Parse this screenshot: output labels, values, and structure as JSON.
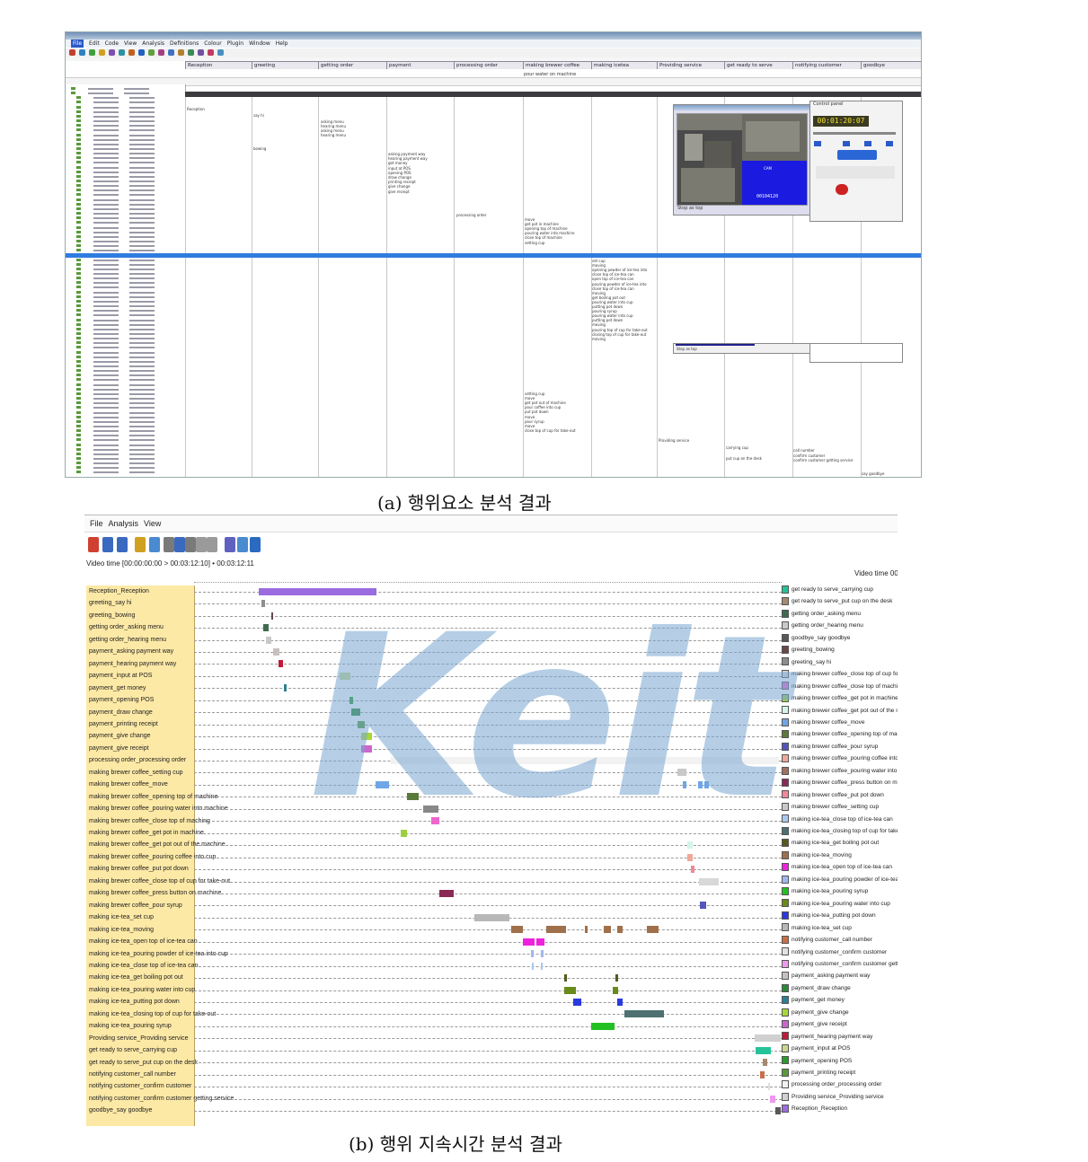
{
  "figure_a": {
    "caption": "(a) 행위요소 분석 결과",
    "menu": [
      "File",
      "Edit",
      "Code",
      "View",
      "Analysis",
      "Definitions",
      "Colour",
      "Plugin",
      "Window",
      "Help"
    ],
    "columns": [
      "Reception",
      "greeting",
      "getting order",
      "payment",
      "processing order",
      "making brewer coffee",
      "making icetea",
      "Providing service",
      "get ready to serve",
      "notifying customer",
      "goodbye"
    ],
    "top_note": "pour water on machine",
    "cells": {
      "reception": "Reception",
      "greeting": [
        "say hi",
        "bowing"
      ],
      "getting_order": [
        "asking menu",
        "hearing menu",
        "asking menu",
        "hearing menu"
      ],
      "payment": [
        "asking payment way",
        "hearing payment way",
        "get money",
        "input at POS",
        "opening POS",
        "draw change",
        "printing receipt",
        "give change",
        "give receipt"
      ],
      "processing_order": "processing order",
      "coffee_1": [
        "move",
        "get pot in machine",
        "opening top of machine",
        "pouring water into machine",
        "close top of machine",
        "setting cup"
      ],
      "icetea": [
        "set cup",
        "moving",
        "opening powder of ice-tea into",
        "close top of ice-tea can",
        "open top of ice-tea can",
        "pouring powder of ice-tea into",
        "close top of ice-tea can",
        "moving",
        "get boiling pot out",
        "pouring water into cup",
        "putting pot down",
        "pouring syrup",
        "pouring water into cup",
        "putting pot down",
        "moving",
        "pouring top of cup for take-out",
        "closing top of cup for take-out",
        "moving"
      ],
      "coffee_2": [
        "setting cup",
        "move",
        "get pot out of machine",
        "pour coffee into cup",
        "put pot down",
        "move",
        "pour syrup",
        "move",
        "close top of cup for take-out"
      ],
      "providing": "Providing service",
      "ready": [
        "carrying cup",
        "put cup on the desk"
      ],
      "notifying": [
        "call number",
        "confirm customer",
        "confirm customer getting service"
      ],
      "goodbye": "say goodbye"
    },
    "video_caption": "Stop as top",
    "video_caption_2": "Stop as top",
    "video_timecode": "00104120",
    "control_title": "Control panel",
    "control_time": "00:01:20:07"
  },
  "figure_b": {
    "caption": "(b) 행위 지속시간 분석 결과",
    "menu": [
      "File",
      "Analysis",
      "View"
    ],
    "video_time_range": "Video time [00:00:00:00 > 00:03:12:10] • 00:03:12:11",
    "video_time_right": "Video time 00:00:0C",
    "left_labels": [
      "Reception_Reception",
      "greeting_say hi",
      "greeting_bowing",
      "getting order_asking menu",
      "getting order_hearing menu",
      "payment_asking payment way",
      "payment_hearing payment way",
      "payment_input at POS",
      "payment_get money",
      "payment_opening POS",
      "payment_draw change",
      "payment_printing receipt",
      "payment_give change",
      "payment_give receipt",
      "processing order_processing order",
      "making brewer coffee_setting cup",
      "making brewer coffee_move",
      "making brewer coffee_opening top of machine",
      "making brewer coffee_pouring water into machine",
      "making brewer coffee_close top of maching",
      "making brewer coffee_get pot in machine",
      "making brewer coffee_get pot out of the machine",
      "making brewer coffee_pouring coffee into cup",
      "making brewer coffee_put pot down",
      "making brewer coffee_close top of cup for take-out",
      "making brewer coffee_press button on machine",
      "making brewer coffee_pour syrup",
      "making ice-tea_set cup",
      "making ice-tea_moving",
      "making ice-tea_open top of ice-tea can",
      "making ice-tea_pouring powder of ice-tea into cup",
      "making ice-tea_close top of ice-tea can",
      "making ice-tea_get boiling pot out",
      "making ice-tea_pouring water into cup",
      "making ice-tea_putting pot down",
      "making ice-tea_closing top of cup for take-out",
      "making ice-tea_pouring syrup",
      "Providing service_Providing service",
      "get ready to serve_carrying cup",
      "get ready to serve_put cup on the desk",
      "notifying customer_call number",
      "notifying customer_confirm customer",
      "notifying customer_confirm customer getting service",
      "goodbye_say goodbye"
    ],
    "legend": [
      {
        "label": "get ready to serve_carrying cup",
        "color": "#26c29a"
      },
      {
        "label": "get ready to serve_put cup on the desk",
        "color": "#a58a72"
      },
      {
        "label": "getting order_asking menu",
        "color": "#3e6b4e"
      },
      {
        "label": "getting order_hearing menu",
        "color": "#c9c9c9"
      },
      {
        "label": "goodbye_say goodbye",
        "color": "#585858"
      },
      {
        "label": "greeting_bowing",
        "color": "#6a4848"
      },
      {
        "label": "greeting_say hi",
        "color": "#8e8e8e"
      },
      {
        "label": "making brewer coffee_close top of cup for take-out",
        "color": "#d8d8d8"
      },
      {
        "label": "making brewer coffee_close top of maching",
        "color": "#ee66cc"
      },
      {
        "label": "making brewer coffee_get pot in machine",
        "color": "#9ccf40"
      },
      {
        "label": "making brewer coffee_get pot out of the machine",
        "color": "#d6f3e8"
      },
      {
        "label": "making brewer coffee_move",
        "color": "#6fa6e6"
      },
      {
        "label": "making brewer coffee_opening top of machine",
        "color": "#5a7a3a"
      },
      {
        "label": "making brewer coffee_pour syrup",
        "color": "#5555bb"
      },
      {
        "label": "making brewer coffee_pouring coffee into cup",
        "color": "#f0a89a"
      },
      {
        "label": "making brewer coffee_pouring water into maching",
        "color": "#a07060"
      },
      {
        "label": "making brewer coffee_press button on machine",
        "color": "#8a2a55"
      },
      {
        "label": "making brewer coffee_put pot down",
        "color": "#f08898"
      },
      {
        "label": "making brewer coffee_setting cup",
        "color": "#c8c8c8"
      },
      {
        "label": "making ice-tea_close top of ice-tea can",
        "color": "#a8c8f0"
      },
      {
        "label": "making ice-tea_closing top of cup for take-out",
        "color": "#4e7070"
      },
      {
        "label": "making ice-tea_get boiling pot out",
        "color": "#565a1e"
      },
      {
        "label": "making ice-tea_moving",
        "color": "#a0704a"
      },
      {
        "label": "making ice-tea_open top of ice-tea can",
        "color": "#ee22dd"
      },
      {
        "label": "making ice-tea_pouring powder of ice-tea into cup",
        "color": "#a0b8f0"
      },
      {
        "label": "making ice-tea_pouring syrup",
        "color": "#22c022"
      },
      {
        "label": "making ice-tea_pouring water into cup",
        "color": "#6a8a1a"
      },
      {
        "label": "making ice-tea_putting pot down",
        "color": "#2a3ae0"
      },
      {
        "label": "making ice-tea_set cup",
        "color": "#b8b8b8"
      },
      {
        "label": "notifying customer_call number",
        "color": "#c87048"
      },
      {
        "label": "notifying customer_confirm customer",
        "color": "#e0e0e0"
      },
      {
        "label": "notifying customer_confirm customer getting service",
        "color": "#ee99ee"
      },
      {
        "label": "payment_asking payment way",
        "color": "#c8c0c0"
      },
      {
        "label": "payment_draw change",
        "color": "#2a8a3a"
      },
      {
        "label": "payment_get money",
        "color": "#2a8090"
      },
      {
        "label": "payment_give change",
        "color": "#a8d838"
      },
      {
        "label": "payment_give receipt",
        "color": "#cc66cc"
      },
      {
        "label": "payment_hearing payment way",
        "color": "#c01a3a"
      },
      {
        "label": "payment_input at POS",
        "color": "#c8d890"
      },
      {
        "label": "payment_opening POS",
        "color": "#2a9a2a"
      },
      {
        "label": "payment_printing receipt",
        "color": "#5a9a3a"
      },
      {
        "label": "processing order_processing order",
        "color": "#f2f2f2"
      },
      {
        "label": "Providing service_Providing service",
        "color": "#d0d0d0"
      },
      {
        "label": "Reception_Reception",
        "color": "#9b6ce0"
      }
    ],
    "bars": [
      [
        [
          0.11,
          0.31
        ]
      ],
      [
        [
          0.115,
          0.121
        ]
      ],
      [
        [
          0.132,
          0.135
        ]
      ],
      [
        [
          0.118,
          0.127
        ]
      ],
      [
        [
          0.122,
          0.131
        ]
      ],
      [
        [
          0.135,
          0.145
        ]
      ],
      [
        [
          0.143,
          0.152
        ]
      ],
      [
        [
          0.248,
          0.266
        ]
      ],
      [
        [
          0.153,
          0.158
        ]
      ],
      [
        [
          0.265,
          0.27
        ]
      ],
      [
        [
          0.268,
          0.283
        ]
      ],
      [
        [
          0.278,
          0.29
        ]
      ],
      [
        [
          0.284,
          0.302
        ]
      ],
      [
        [
          0.284,
          0.302
        ]
      ],
      [
        [
          0.335,
          0.996
        ]
      ],
      [
        [
          0.822,
          0.838
        ]
      ],
      [
        [
          0.309,
          0.332
        ],
        [
          0.832,
          0.838
        ],
        [
          0.858,
          0.866
        ],
        [
          0.868,
          0.876
        ]
      ],
      [
        [
          0.363,
          0.383
        ]
      ],
      [
        [
          0.39,
          0.416
        ]
      ],
      [
        [
          0.403,
          0.418
        ]
      ],
      [
        [
          0.352,
          0.362
        ]
      ],
      [
        [
          0.84,
          0.848
        ]
      ],
      [
        [
          0.84,
          0.848
        ]
      ],
      [
        [
          0.845,
          0.851
        ]
      ],
      [
        [
          0.859,
          0.893
        ]
      ],
      [
        [
          0.418,
          0.442
        ]
      ],
      [
        [
          0.861,
          0.871
        ]
      ],
      [
        [
          0.477,
          0.536
        ]
      ],
      [
        [
          0.54,
          0.559
        ],
        [
          0.6,
          0.633
        ],
        [
          0.665,
          0.669
        ],
        [
          0.697,
          0.709
        ],
        [
          0.72,
          0.73
        ],
        [
          0.77,
          0.79
        ]
      ],
      [
        [
          0.559,
          0.58
        ],
        [
          0.583,
          0.597
        ]
      ],
      [
        [
          0.573,
          0.578
        ],
        [
          0.59,
          0.595
        ]
      ],
      [
        [
          0.575,
          0.577
        ],
        [
          0.59,
          0.592
        ]
      ],
      [
        [
          0.63,
          0.635
        ],
        [
          0.717,
          0.721
        ]
      ],
      [
        [
          0.63,
          0.65
        ],
        [
          0.713,
          0.721
        ]
      ],
      [
        [
          0.646,
          0.659
        ],
        [
          0.72,
          0.729
        ]
      ],
      [
        [
          0.733,
          0.799
        ]
      ],
      [
        [
          0.676,
          0.715
        ]
      ],
      [
        [
          0.954,
          0.999
        ]
      ],
      [
        [
          0.956,
          0.982
        ]
      ],
      [
        [
          0.968,
          0.975
        ]
      ],
      [
        [
          0.964,
          0.971
        ]
      ],
      [
        [
          0.977,
          0.98
        ]
      ],
      [
        [
          0.98,
          0.99
        ]
      ],
      [
        [
          0.99,
          0.998
        ]
      ]
    ],
    "watermark": "Keit"
  }
}
